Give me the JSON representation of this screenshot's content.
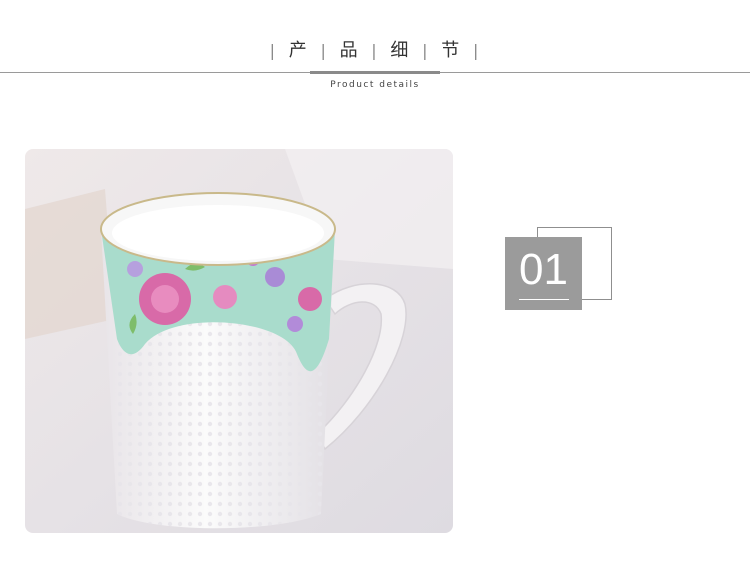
{
  "header": {
    "title_chars": [
      "产",
      "品",
      "细",
      "节"
    ],
    "subtitle": "Product details"
  },
  "detail": {
    "number": "01"
  },
  "colors": {
    "accent_gray": "#9b9b9b",
    "line_gray": "#9a9a9a",
    "mug_band": "#a9dccc",
    "rose_pink": "#d86aa8"
  }
}
